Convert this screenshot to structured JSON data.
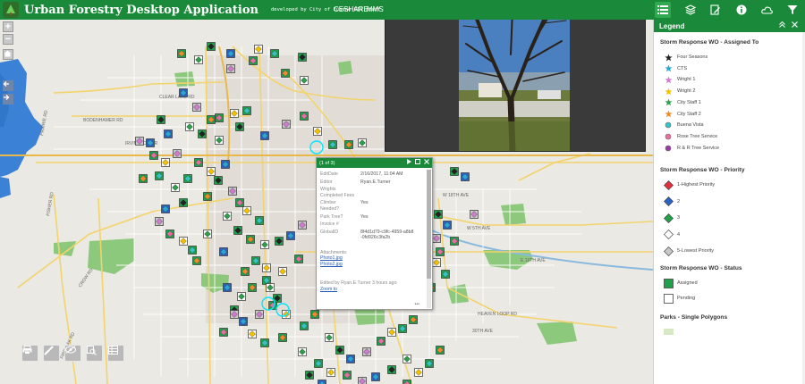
{
  "header": {
    "title": "Urban Forestry Desktop Application",
    "subtitle": "developed by City of Eugene GIS staff",
    "links": [
      "CESHARE",
      "MMS"
    ]
  },
  "toolbar": {
    "icons": [
      "list-icon",
      "layers-icon",
      "edit-icon",
      "info-icon",
      "cloud-icon",
      "filter-icon"
    ]
  },
  "map": {
    "road_labels": [
      "CLEAR LAKE RD",
      "BODENHAMER RD",
      "IRVINGTON DR",
      "PRAIRIE RD",
      "FISHER RD",
      "CROW RD",
      "FIRE OAK RD",
      "W 18TH AVE",
      "W 5TH AVE",
      "E 19TH AVE",
      "HEAVEN LOOP RD",
      "30TH AVE"
    ]
  },
  "popup": {
    "title": "(1 of 3)",
    "rows": [
      {
        "key": "EditDate",
        "value": "2/16/2017, 11:04 AM"
      },
      {
        "key": "Editor",
        "value": "Ryan.E.Turner"
      },
      {
        "key": "Wrights Completed Fees",
        "value": ""
      },
      {
        "key": "Climber Needed?",
        "value": "Yes"
      },
      {
        "key": "Park Tree?",
        "value": "Yes"
      },
      {
        "key": "Invoice #",
        "value": ""
      },
      {
        "key": "GlobalID",
        "value": "8f4d1d79-c9fc-4959-a8b8-0fd926c3fa2b"
      }
    ],
    "attachments_label": "Attachments:",
    "attachments": [
      "Photo1.jpg",
      "Photo2.jpg"
    ],
    "edited_by": "Edited by Ryan.E.Turner 3 hours ago",
    "zoom_to": "Zoom to",
    "more": "•••"
  },
  "legend": {
    "title": "Legend",
    "groups": [
      {
        "title": "Storm Response WO - Assigned To",
        "items": [
          {
            "label": "Four Seasons",
            "shape": "star",
            "color": "#222222"
          },
          {
            "label": "CTS",
            "shape": "star",
            "color": "#2aa6d6"
          },
          {
            "label": "Wright 1",
            "shape": "star",
            "color": "#d07ad0"
          },
          {
            "label": "Wright 2",
            "shape": "star",
            "color": "#f2c200"
          },
          {
            "label": "City Staff 1",
            "shape": "star",
            "color": "#2e9e4a"
          },
          {
            "label": "City Staff 2",
            "shape": "star",
            "color": "#f28a2a"
          },
          {
            "label": "Buena Vista",
            "shape": "circle",
            "color": "#35c3c3"
          },
          {
            "label": "Rose Tree Service",
            "shape": "circle",
            "color": "#e76fa0"
          },
          {
            "label": "R & R Tree Service",
            "shape": "circle",
            "color": "#9b3aa8"
          }
        ]
      },
      {
        "title": "Storm Response WO - Priority",
        "items": [
          {
            "label": "1-Highest Priority",
            "shape": "diamond",
            "color": "#e0303a"
          },
          {
            "label": "2",
            "shape": "diamond",
            "color": "#2a62c0"
          },
          {
            "label": "3",
            "shape": "diamond",
            "color": "#1fa04a"
          },
          {
            "label": "4",
            "shape": "diamond",
            "color": "#ffffff"
          },
          {
            "label": "5-Lowest Priority",
            "shape": "diamond",
            "color": "#c8c8c8"
          }
        ]
      },
      {
        "title": "Storm Response WO - Status",
        "items": [
          {
            "label": "Assigned",
            "shape": "square",
            "color": "#1fa04a"
          },
          {
            "label": "Pending",
            "shape": "square",
            "color": "#ffffff"
          }
        ]
      },
      {
        "title": "Parks - Single Polygons",
        "items": [
          {
            "label": "",
            "shape": "park",
            "color": "#d6e9c4"
          }
        ]
      }
    ]
  },
  "colors": {
    "header": "#1a8a3a",
    "water": "#3b82d6",
    "park": "#7dc36b",
    "major_road": "#f3d36b",
    "minor_road": "#ffffff"
  }
}
